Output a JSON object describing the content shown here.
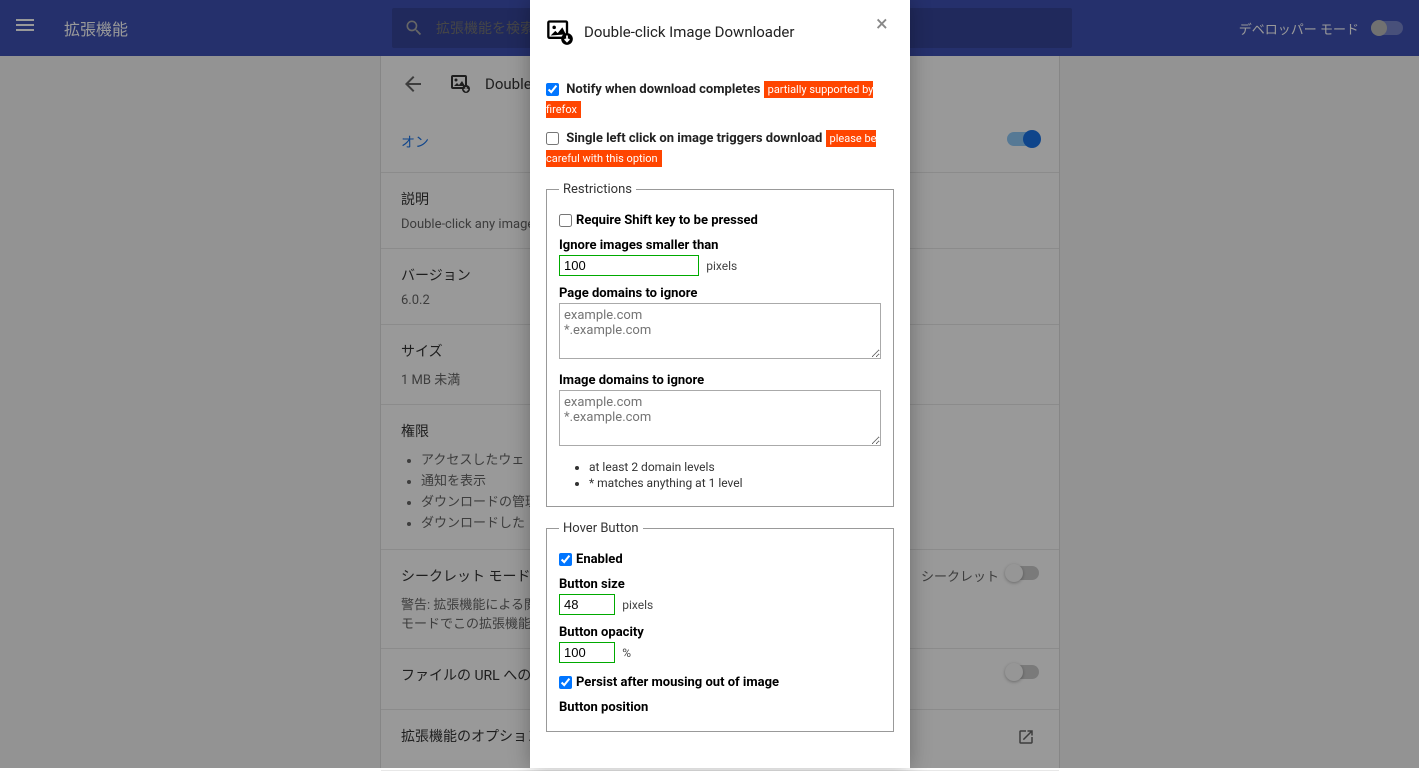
{
  "header": {
    "title": "拡張機能",
    "search_placeholder": "拡張機能を検索",
    "dev_mode_label": "デベロッパー モード"
  },
  "panel": {
    "ext_name": "Double-",
    "on_label": "オン",
    "desc_title": "説明",
    "desc_value": "Double-click any image",
    "version_title": "バージョン",
    "version_value": "6.0.2",
    "size_title": "サイズ",
    "size_value": "1 MB 未満",
    "perm_title": "権限",
    "perms": [
      "アクセスしたウェ",
      "通知を表示",
      "ダウンロードの管理",
      "ダウンロードした"
    ],
    "incognito_title": "シークレット モードで",
    "incognito_warn": "警告: 拡張機能による閲",
    "incognito_warn2": "モードでこの拡張機能",
    "incognito_right": "シークレット",
    "file_url_title": "ファイルの URL への",
    "options_title": "拡張機能のオプション"
  },
  "modal": {
    "title": "Double-click Image Downloader",
    "notify_label": "Notify when download completes",
    "notify_badge": "partially supported by firefox",
    "single_click_label": "Single left click on image triggers download",
    "single_click_badge": "please be careful with this option",
    "restrictions": {
      "legend": "Restrictions",
      "require_shift": "Require Shift key to be pressed",
      "ignore_smaller": "Ignore images smaller than",
      "ignore_smaller_value": "100",
      "pixels": "pixels",
      "page_domains": "Page domains to ignore",
      "page_domains_placeholder": "example.com\n*.example.com",
      "image_domains": "Image domains to ignore",
      "image_domains_placeholder": "example.com\n*.example.com",
      "note1": "at least 2 domain levels",
      "note2": "* matches anything at 1 level"
    },
    "hover": {
      "legend": "Hover Button",
      "enabled": "Enabled",
      "button_size": "Button size",
      "button_size_value": "48",
      "button_size_unit": "pixels",
      "opacity": "Button opacity",
      "opacity_value": "100",
      "opacity_unit": "%",
      "persist": "Persist after mousing out of image",
      "position": "Button position"
    }
  }
}
